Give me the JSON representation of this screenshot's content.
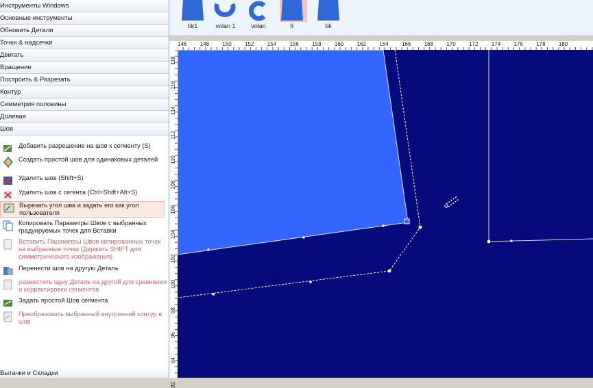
{
  "sidebar": {
    "categories": [
      "Инструменты Windows",
      "Основные инструменты",
      "Обновить Детали",
      "Точки & надсечки",
      "Двигать",
      "Вращение",
      "Построить & Разрезать",
      "Контур",
      "Симметрия половины",
      "Долевая",
      "Шов"
    ],
    "tools": [
      {
        "label": "Добавить разрешение на шов к сегменту (S)",
        "icon": "add-seam-icon",
        "enabled": true
      },
      {
        "label": "Создать простой шов для одинаковых деталей",
        "icon": "diamond-icon",
        "enabled": true
      },
      {
        "label": "Удалить шов (Shift+S)",
        "icon": "delete-seam-icon",
        "enabled": true
      },
      {
        "label": "Удалить шов с сегента (Ctrl+Shift+Alt+S)",
        "icon": "delete-segment-seam-icon",
        "enabled": true
      },
      {
        "label": "Вырезать угол шва и задать его как угол пользователя",
        "icon": "cut-corner-icon",
        "enabled": true,
        "selected": true
      },
      {
        "label": "Копировать Параметры Швов с выбранных градуируемых точек для Вставки",
        "icon": "copy-params-icon",
        "enabled": true
      },
      {
        "label": "Вставить Параметры Швов копированных точек на выбранные точки (Держать SHIFT для симметрического изображения)",
        "icon": "paste-params-icon",
        "enabled": false
      },
      {
        "label": "Перенести шов на другую Деталь",
        "icon": "transfer-seam-icon",
        "enabled": true
      },
      {
        "label": "разместить одну Деталь на другой для сравнения и корректировки сегментов",
        "icon": "overlay-piece-icon",
        "enabled": false
      },
      {
        "label": "Задать простой Шов сегмента",
        "icon": "simple-seam-icon",
        "enabled": true
      },
      {
        "label": "Преобразовать выбранный внутренний контур в шов",
        "icon": "convert-contour-icon",
        "enabled": false
      }
    ],
    "bottom_category": "Вытачки и Складки"
  },
  "pieces": [
    {
      "label": "bk1",
      "shape": "bodice"
    },
    {
      "label": "volan 1",
      "shape": "ring"
    },
    {
      "label": "volan",
      "shape": "ring-open"
    },
    {
      "label": "fr",
      "shape": "bodice",
      "active": true
    },
    {
      "label": "bk",
      "shape": "bodice"
    }
  ],
  "ruler": {
    "horizontal": [
      "146",
      "148",
      "150",
      "152",
      "154",
      "156",
      "158",
      "160",
      "162",
      "164",
      "166",
      "168",
      "170",
      "172",
      "174",
      "176",
      "178",
      "180"
    ],
    "vertical": [
      "118",
      "116",
      "114",
      "112",
      "110",
      "108",
      "106",
      "104",
      "102",
      "100",
      "98",
      "96",
      "94",
      "92"
    ]
  },
  "colors": {
    "canvas": "#050a7d",
    "piece_fill": "#3366ff",
    "seam_line": "#ffffcc",
    "piece_outline": "#e0e0ff",
    "active_tab": "#f6c4c0"
  }
}
